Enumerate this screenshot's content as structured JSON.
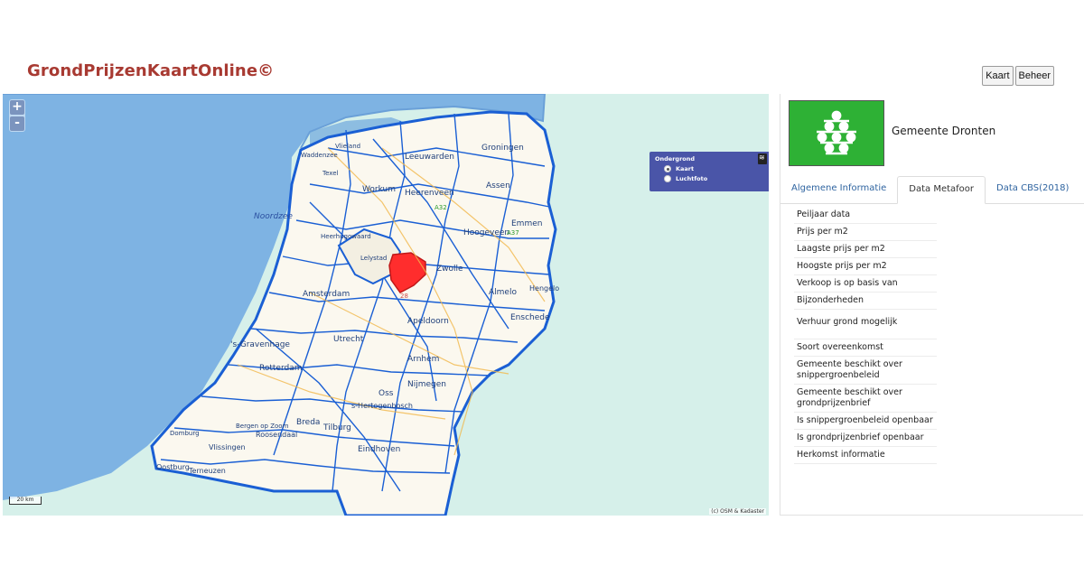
{
  "app": {
    "title": "GrondPrijzenKaartOnline©"
  },
  "top_buttons": {
    "kaart": "Kaart",
    "beheer": "Beheer"
  },
  "map": {
    "zoom_in": "+",
    "zoom_out": "-",
    "layer_control": {
      "title": "Ondergrond",
      "options": [
        "Kaart",
        "Luchtfoto"
      ],
      "selected": "Kaart"
    },
    "scale_label": "20 km",
    "attribution": "(c) OSM & Kadaster",
    "labels": {
      "sea": "Noordzee",
      "waddenzee": "Waddenzee",
      "vlieland": "Vlieland",
      "texel": "Texel",
      "leeuwarden": "Leeuwarden",
      "groningen": "Groningen",
      "heerenveen": "Heerenveen",
      "workum": "Workum",
      "assen": "Assen",
      "emmen": "Emmen",
      "hoogeveen": "Hoogeveen",
      "zwolle": "Zwolle",
      "almelo": "Almelo",
      "enschede": "Enschede",
      "hengelo": "Hengelo",
      "amsterdam": "Amsterdam",
      "apeldoorn": "Apeldoorn",
      "utrecht": "Utrecht",
      "arnhem": "Arnhem",
      "nijmegen": "Nijmegen",
      "denhaag": "'s-Gravenhage",
      "rotterdam": "Rotterdam",
      "oss": "Oss",
      "sHertogenbosch": "s-Hertogenbosch",
      "tilburg": "Tilburg",
      "eindhoven": "Eindhoven",
      "breda": "Breda",
      "roosendaal": "Roosendaal",
      "bergen": "Bergen op Zoom",
      "vlissingen": "Vlissingen",
      "terneuzen": "Terneuzen",
      "oostburg": "Oostburg",
      "domburg": "Domburg",
      "heerhugowaard": "Heerhugowaard",
      "lelystad": "Lelystad",
      "a32": "A32",
      "a37": "A37",
      "a28": "28"
    },
    "highlight_color": "#ff2d2d",
    "border_color": "#1a5fd4"
  },
  "panel": {
    "municipality": "Gemeente Dronten",
    "flag_color": "#2eb135",
    "tabs": [
      "Algemene Informatie",
      "Data Metafoor",
      "Data CBS(2018)"
    ],
    "active_tab": "Data Metafoor",
    "fields": [
      "Peiljaar data",
      "Prijs per m2",
      "Laagste prijs per m2",
      "Hoogste prijs per m2",
      "Verkoop is op basis van",
      "Bijzonderheden",
      "Verhuur grond mogelijk",
      "Soort overeenkomst",
      "Gemeente beschikt over snippergroenbeleid",
      "Gemeente beschikt over grondprijzenbrief",
      "Is snippergroenbeleid openbaar",
      "Is grondprijzenbrief openbaar",
      "Herkomst informatie"
    ]
  }
}
